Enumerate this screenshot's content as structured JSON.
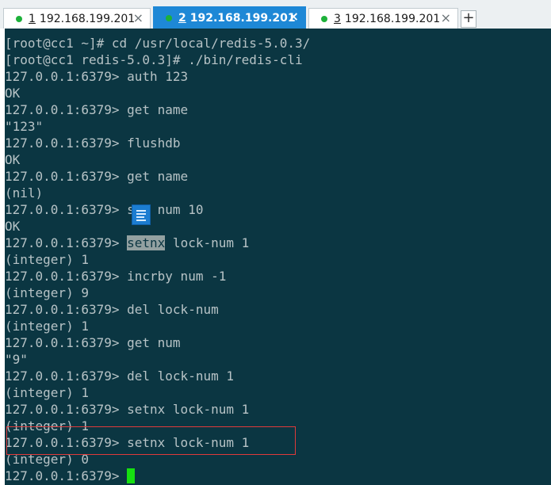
{
  "tabs": [
    {
      "number": "1",
      "title": "192.168.199.201",
      "close": "×"
    },
    {
      "number": "2",
      "title": "192.168.199.201",
      "close": "×"
    },
    {
      "number": "3",
      "title": "192.168.199.201",
      "close": "×"
    }
  ],
  "new_tab_label": "+",
  "terminal": {
    "lines": [
      "[root@cc1 ~]# cd /usr/local/redis-5.0.3/",
      "[root@cc1 redis-5.0.3]# ./bin/redis-cli",
      "127.0.0.1:6379> auth 123",
      "OK",
      "127.0.0.1:6379> get name",
      "\"123\"",
      "127.0.0.1:6379> flushdb",
      "OK",
      "127.0.0.1:6379> get name",
      "(nil)",
      "127.0.0.1:6379> set num 10",
      "OK",
      "127.0.0.1:6379> setnx lock-num 1",
      "(integer) 1",
      "127.0.0.1:6379> incrby num -1",
      "(integer) 9",
      "127.0.0.1:6379> del lock-num",
      "(integer) 1",
      "127.0.0.1:6379> get num",
      "\"9\"",
      "127.0.0.1:6379> del lock-num 1",
      "(integer) 1",
      "127.0.0.1:6379> setnx lock-num 1",
      "(integer) 1",
      "127.0.0.1:6379> setnx lock-num 1",
      "(integer) 0",
      "127.0.0.1:6379> "
    ],
    "selected_word": "setnx",
    "selected_line_index": 12
  },
  "colors": {
    "background": "#0b3642",
    "text": "#b7c3c6",
    "cursor": "#16e010",
    "active_tab": "#1e88d6",
    "status_dot": "#1db13a",
    "annotation_box": "#e03a3a"
  },
  "icons": {
    "status": "connected-dot-icon",
    "close": "close-icon",
    "overlay": "document-icon"
  }
}
